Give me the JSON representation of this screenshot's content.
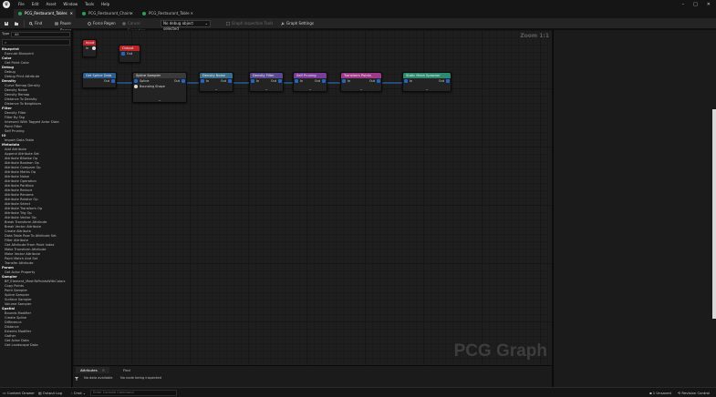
{
  "menu": [
    "File",
    "Edit",
    "Asset",
    "Window",
    "Tools",
    "Help"
  ],
  "window_controls": [
    "–",
    "□",
    "✕"
  ],
  "tabs": [
    {
      "label": "PCG_Restaurant_Tables",
      "close": "✕"
    },
    {
      "label": "PCG_Restaurant_Chairs",
      "close": "✕"
    },
    {
      "label": "PCG_Restaurant_Table",
      "close": "✕"
    }
  ],
  "toolbar": {
    "save_icon": "save-icon",
    "find_label": "Find",
    "pause_regen_label": "Pause Regen",
    "force_regen_label": "Force Regen",
    "cancel_execution_label": "Cancel Execution",
    "debug_select_value": "No debug object selected",
    "graph_inspection_label": "Graph Inspection Tools",
    "graph_settings_label": "Graph Settings"
  },
  "left_panel": {
    "type_label": "Type",
    "type_value": "All",
    "search_placeholder": "",
    "items": [
      {
        "label": "Blueprint",
        "cat": true
      },
      {
        "label": "Execute Blueprint",
        "cat": false
      },
      {
        "label": "Color",
        "cat": true
      },
      {
        "label": "Get Point Color",
        "cat": false
      },
      {
        "label": "Debug",
        "cat": true
      },
      {
        "label": "Debug",
        "cat": false
      },
      {
        "label": "Debug Print Attribute",
        "cat": false
      },
      {
        "label": "Density",
        "cat": true
      },
      {
        "label": "Curve Remap Density",
        "cat": false
      },
      {
        "label": "Density Noise",
        "cat": false
      },
      {
        "label": "Density Remap",
        "cat": false
      },
      {
        "label": "Distance To Density",
        "cat": false
      },
      {
        "label": "Distance To Neighbors",
        "cat": false
      },
      {
        "label": "Filter",
        "cat": true
      },
      {
        "label": "Density Filter",
        "cat": false
      },
      {
        "label": "Filter By Tag",
        "cat": false
      },
      {
        "label": "Intersect With Tagged Actor Data",
        "cat": false
      },
      {
        "label": "Point Filter",
        "cat": false
      },
      {
        "label": "Self Pruning",
        "cat": false
      },
      {
        "label": "IO",
        "cat": true
      },
      {
        "label": "Import Data Table",
        "cat": false
      },
      {
        "label": "Metadata",
        "cat": true
      },
      {
        "label": "Add Attribute",
        "cat": false
      },
      {
        "label": "Append Attribute Set",
        "cat": false
      },
      {
        "label": "Attribute Bitwise Op",
        "cat": false
      },
      {
        "label": "Attribute Boolean Op",
        "cat": false
      },
      {
        "label": "Attribute Compare Op",
        "cat": false
      },
      {
        "label": "Attribute Maths Op",
        "cat": false
      },
      {
        "label": "Attribute Noise",
        "cat": false
      },
      {
        "label": "Attribute Operation",
        "cat": false
      },
      {
        "label": "Attribute Partition",
        "cat": false
      },
      {
        "label": "Attribute Reduce",
        "cat": false
      },
      {
        "label": "Attribute Rename",
        "cat": false
      },
      {
        "label": "Attribute Rotator Op",
        "cat": false
      },
      {
        "label": "Attribute Select",
        "cat": false
      },
      {
        "label": "Attribute Transform Op",
        "cat": false
      },
      {
        "label": "Attribute Trig Op",
        "cat": false
      },
      {
        "label": "Attribute Vector Op",
        "cat": false
      },
      {
        "label": "Break Transform Attribute",
        "cat": false
      },
      {
        "label": "Break Vector Attribute",
        "cat": false
      },
      {
        "label": "Create Attribute",
        "cat": false
      },
      {
        "label": "Data Table Row To Attribute Set",
        "cat": false
      },
      {
        "label": "Filter Attribute",
        "cat": false
      },
      {
        "label": "Get Attribute From Point Index",
        "cat": false
      },
      {
        "label": "Make Transform Attribute",
        "cat": false
      },
      {
        "label": "Make Vector Attribute",
        "cat": false
      },
      {
        "label": "Point Match And Set",
        "cat": false
      },
      {
        "label": "Transfer Attribute",
        "cat": false
      },
      {
        "label": "Param",
        "cat": true
      },
      {
        "label": "Get Actor Property",
        "cat": false
      },
      {
        "label": "Sampler",
        "cat": true
      },
      {
        "label": "BP_Element_MeshToPointsWithColors",
        "cat": false
      },
      {
        "label": "Copy Points",
        "cat": false
      },
      {
        "label": "Point Sampler",
        "cat": false
      },
      {
        "label": "Spline Sampler",
        "cat": false
      },
      {
        "label": "Surface Sampler",
        "cat": false
      },
      {
        "label": "Volume Sampler",
        "cat": false
      },
      {
        "label": "Spatial",
        "cat": true
      },
      {
        "label": "Bounds Modifier",
        "cat": false
      },
      {
        "label": "Create Spline",
        "cat": false
      },
      {
        "label": "Difference",
        "cat": false
      },
      {
        "label": "Distance",
        "cat": false
      },
      {
        "label": "Extents Modifier",
        "cat": false
      },
      {
        "label": "Gather",
        "cat": false
      },
      {
        "label": "Get Actor Data",
        "cat": false
      },
      {
        "label": "Get Landscape Data",
        "cat": false
      }
    ]
  },
  "graph": {
    "zoom": "Zoom 1:1",
    "watermark": "PCG Graph",
    "nodes": {
      "input": {
        "title": "Input",
        "pin_in": "In"
      },
      "output": {
        "title": "Output",
        "pin_out": "Out"
      },
      "get_spline": {
        "title": "Get Spline Data",
        "pin_out": "Out"
      },
      "spline_sampler": {
        "title": "Spline Sampler",
        "pin_in": "Spline",
        "pin_out": "Out",
        "extra_pin": "Bounding Shape"
      },
      "density_noise": {
        "title": "Density Noise",
        "pin_in": "In",
        "pin_out": "Out"
      },
      "density_filter": {
        "title": "Density Filter",
        "pin_in": "In",
        "pin_out": "Out"
      },
      "self_pruning": {
        "title": "Self Pruning",
        "pin_in": "In",
        "pin_out": "Out"
      },
      "transform_points": {
        "title": "Transform Points",
        "pin_in": "In",
        "pin_out": "Out"
      },
      "static_mesh_spawner": {
        "title": "Static Mesh Spawner",
        "pin_in": "In",
        "pin_out": "Out"
      }
    },
    "colors": {
      "io": "#b5262b",
      "get_data": "#2e5f8f",
      "sampler": "#3a3a3a",
      "density": "#3c6f8c",
      "filter": "#5c4a91",
      "pruning": "#7a3e9a",
      "transform": "#9e3a8a",
      "spawner": "#2e8a6f",
      "edge": "#2a7bd4"
    }
  },
  "bottom": {
    "tabs": [
      "Attributes",
      "Find"
    ],
    "close": "✕",
    "filter_icon": "filter-icon",
    "status": "No data available",
    "info": "No node being inspected"
  },
  "statusbar": {
    "content_drawer": "Content Drawer",
    "output_log": "Output Log",
    "cmd": "Cmd",
    "cmd_placeholder": "Enter Console Command",
    "unsaved": "1 Unsaved",
    "revision_control": "Revision Control"
  }
}
